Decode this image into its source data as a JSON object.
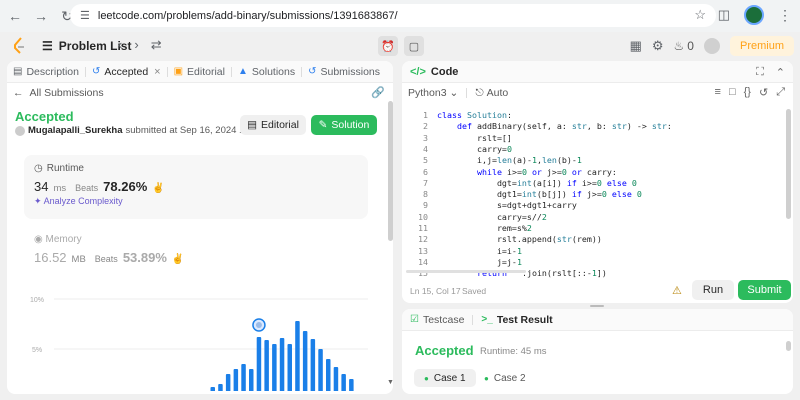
{
  "browser": {
    "url": "leetcode.com/problems/add-binary/submissions/1391683867/",
    "icons": [
      "back-icon",
      "forward-icon",
      "reload-icon",
      "tune-icon",
      "bookmark-star-icon",
      "extensions-icon",
      "profile-avatar",
      "menu-kebab-icon"
    ]
  },
  "topnav": {
    "problem_list_label": "Problem List",
    "streak_count": "0",
    "premium_label": "Premium"
  },
  "left": {
    "tabs": [
      {
        "label": "Description"
      },
      {
        "label": "Accepted"
      },
      {
        "label": "Editorial"
      },
      {
        "label": "Solutions"
      },
      {
        "label": "Submissions"
      }
    ],
    "all_submissions_label": "All Submissions",
    "status": "Accepted",
    "submitter": "Mugalapalli_Surekha",
    "submitted_text": "submitted at Sep 16, 2024 10:07",
    "editorial_btn": "Editorial",
    "solution_btn": "Solution",
    "runtime": {
      "label": "Runtime",
      "value": "34",
      "unit": "ms",
      "beats_label": "Beats",
      "beats_pct": "78.26%"
    },
    "analyze_label": "Analyze Complexity",
    "memory": {
      "label": "Memory",
      "value": "16.52",
      "unit": "MB",
      "beats_label": "Beats",
      "beats_pct": "53.89%"
    }
  },
  "chart_data": {
    "type": "bar",
    "yticks": [
      "10%",
      "5%"
    ],
    "ylim": [
      0,
      10
    ],
    "values": [
      0.1,
      0.2,
      0.3,
      0.5,
      0.8,
      1.2,
      1.5,
      2.5,
      3.0,
      3.5,
      3.0,
      6.2,
      5.9,
      5.5,
      6.1,
      5.5,
      7.8,
      6.8,
      6.0,
      5.0,
      4.0,
      3.2,
      2.5,
      2.0
    ],
    "highlight_index": 11
  },
  "code": {
    "title": "Code",
    "language": "Python3",
    "autocomplete": "Auto",
    "lines": [
      "class Solution:",
      "    def addBinary(self, a: str, b: str) -> str:",
      "        rslt=[]",
      "        carry=0",
      "        i,j=len(a)-1,len(b)-1",
      "        while i>=0 or j>=0 or carry:",
      "            dgt=int(a[i]) if i>=0 else 0",
      "            dgt1=int(b[j]) if j>=0 else 0",
      "            s=dgt+dgt1+carry",
      "            carry=s//2",
      "            rem=s%2",
      "            rslt.append(str(rem))",
      "            i=i-1",
      "            j=j-1",
      "        return \"\".join(rslt[::-1])"
    ],
    "cursor": "Ln 15, Col 17",
    "saved": "Saved",
    "run_label": "Run",
    "submit_label": "Submit"
  },
  "result": {
    "testcase_tab": "Testcase",
    "result_tab": "Test Result",
    "status": "Accepted",
    "runtime_text": "Runtime: 45 ms",
    "cases": [
      "Case 1",
      "Case 2"
    ]
  },
  "colors": {
    "accent_green": "#2cbb5d",
    "premium_orange": "#ffa116",
    "chart_bar": "#1a7fe8"
  }
}
